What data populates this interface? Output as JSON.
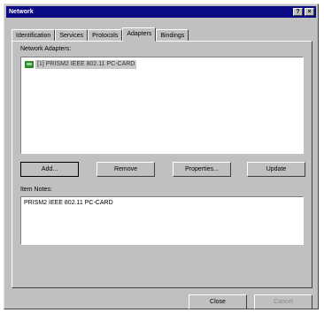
{
  "window": {
    "title": "Network"
  },
  "title_buttons": {
    "help": "?",
    "close": "×"
  },
  "tabs": [
    {
      "label": "Identification"
    },
    {
      "label": "Services"
    },
    {
      "label": "Protocols"
    },
    {
      "label": "Adapters",
      "active": true
    },
    {
      "label": "Bindings"
    }
  ],
  "adapters": {
    "label": "Network Adapters:",
    "items": [
      {
        "text": "[1] PRISM2 IEEE 802.11 PC-CARD"
      }
    ]
  },
  "buttons": {
    "add": "Add...",
    "remove": "Remove",
    "properties": "Properties...",
    "update": "Update"
  },
  "notes": {
    "label": "Item Notes:",
    "text": "PRISM2 IEEE 802.11 PC-CARD"
  },
  "footer": {
    "close": "Close",
    "cancel": "Cancel"
  }
}
